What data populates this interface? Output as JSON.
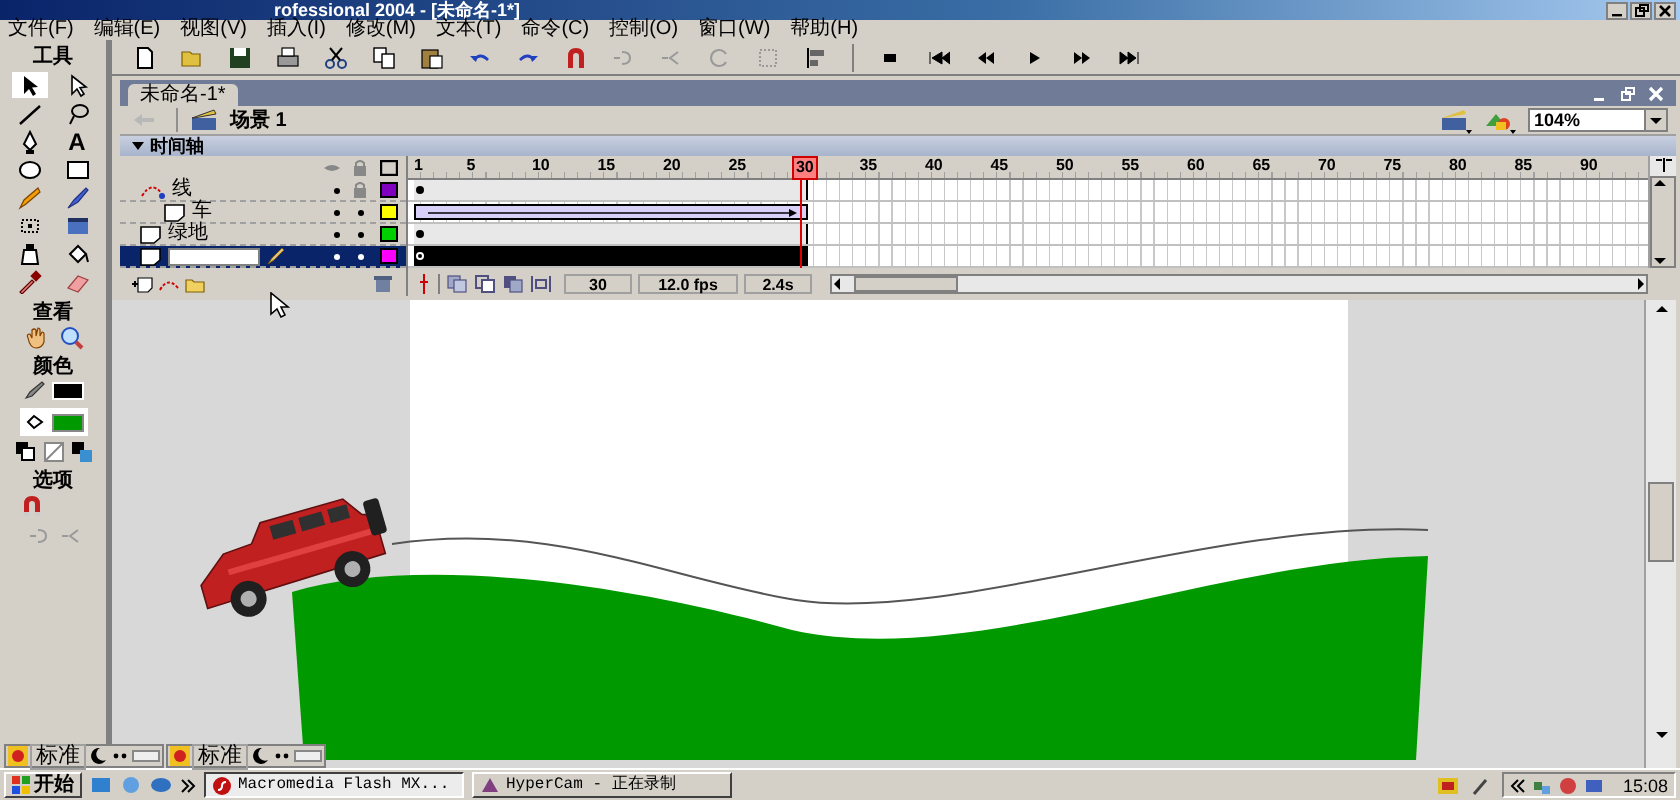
{
  "title_bar": {
    "title": "rofessional 2004 - [未命名-1*]"
  },
  "menu": [
    "文件(F)",
    "编辑(E)",
    "视图(V)",
    "插入(I)",
    "修改(M)",
    "文本(T)",
    "命令(C)",
    "控制(O)",
    "窗口(W)",
    "帮助(H)"
  ],
  "tools_panel": {
    "title": "工具",
    "text_tool": "A",
    "sections": [
      "查看",
      "颜色",
      "选项"
    ]
  },
  "document": {
    "tab": "未命名-1*",
    "scene": "场景 1",
    "zoom": "104%"
  },
  "timeline": {
    "title": "时间轴",
    "frame_numbers": [
      {
        "label": "1",
        "selected": false
      },
      {
        "label": "5",
        "selected": false
      },
      {
        "label": "10",
        "selected": false
      },
      {
        "label": "15",
        "selected": false
      },
      {
        "label": "20",
        "selected": false
      },
      {
        "label": "25",
        "selected": false
      },
      {
        "label": "30",
        "selected": true
      },
      {
        "label": "35",
        "selected": false
      },
      {
        "label": "40",
        "selected": false
      },
      {
        "label": "45",
        "selected": false
      },
      {
        "label": "50",
        "selected": false
      },
      {
        "label": "55",
        "selected": false
      },
      {
        "label": "60",
        "selected": false
      },
      {
        "label": "65",
        "selected": false
      },
      {
        "label": "70",
        "selected": false
      },
      {
        "label": "75",
        "selected": false
      },
      {
        "label": "80",
        "selected": false
      },
      {
        "label": "85",
        "selected": false
      },
      {
        "label": "90",
        "selected": false
      }
    ],
    "layers": [
      {
        "name": "线",
        "kind": "guide",
        "locked": true,
        "color": "#8000c0",
        "tween": false,
        "empty": false,
        "selected": false,
        "children": [
          {
            "name": "车",
            "kind": "normal",
            "locked": false,
            "color": "#ffff00",
            "tween": true,
            "empty": false,
            "selected": false
          }
        ]
      },
      {
        "name": "绿地",
        "kind": "normal",
        "locked": false,
        "color": "#00d000",
        "tween": false,
        "empty": false,
        "selected": false
      },
      {
        "kind": "normal",
        "locked": false,
        "color": "#ff00ff",
        "tween": false,
        "empty": true,
        "selected": true,
        "editing": true
      }
    ],
    "current_frame": "30",
    "frame_rate": "12.0 fps",
    "elapsed_time": "2.4s"
  },
  "ime_bars": [
    {
      "mode": "标准"
    },
    {
      "mode": "标准"
    }
  ],
  "taskbar": {
    "start": "开始",
    "tasks": [
      {
        "label": "Macromedia Flash MX...",
        "selected": true
      },
      {
        "label": "HyperCam - 正在录制",
        "selected": false
      }
    ],
    "clock": "15:08"
  }
}
